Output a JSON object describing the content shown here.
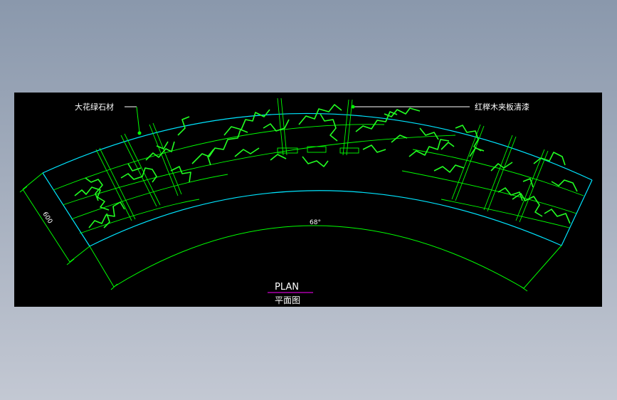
{
  "drawing": {
    "labels": {
      "material_left": "大花绿石材",
      "material_right": "红榉木夹板清漆",
      "dimension_width": "600",
      "angle": "68°",
      "title_en": "PLAN",
      "title_cn": "平面图"
    },
    "colors": {
      "background": "#000000",
      "outline": "#00e5ff",
      "dimension": "#00ff00",
      "marble": "#22ff22",
      "leader": "#ffffff",
      "title_underline": "#ff00ff",
      "page": "#9aa6b8"
    }
  }
}
